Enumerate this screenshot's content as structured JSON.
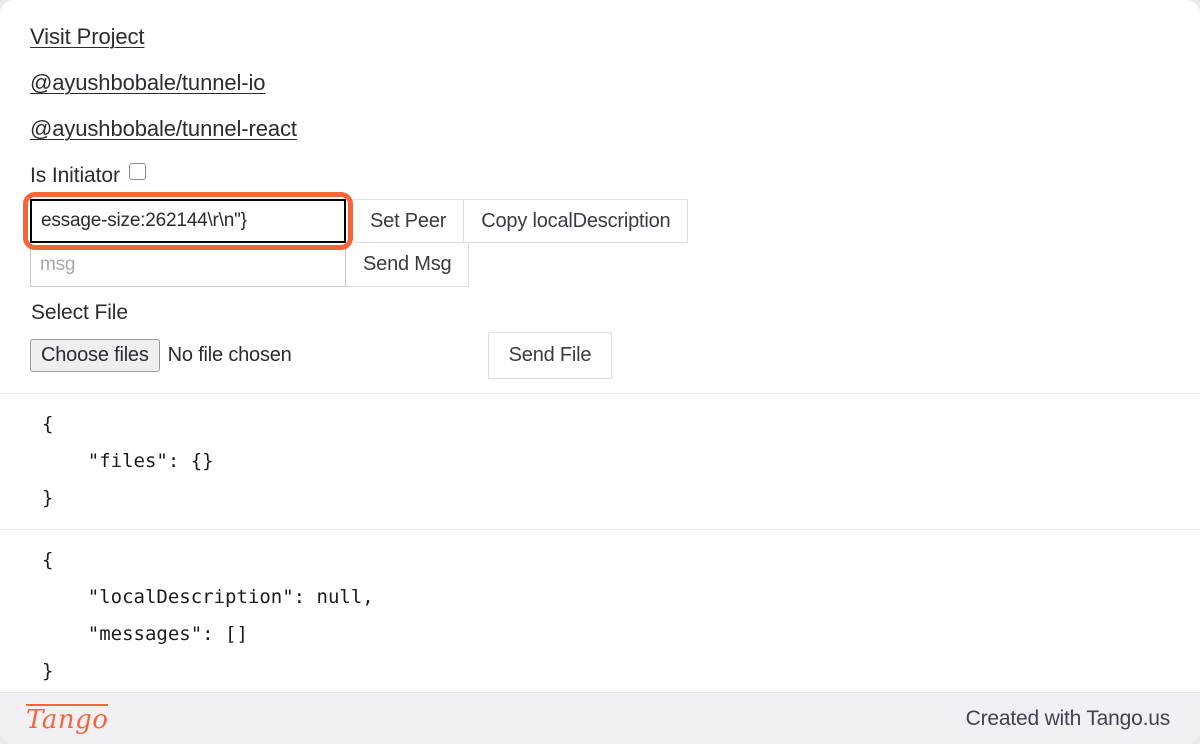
{
  "links": [
    {
      "label": "Visit Project",
      "name": "visit-project-link"
    },
    {
      "label": "@ayushbobale/tunnel-io",
      "name": "tunnel-io-link"
    },
    {
      "label": "@ayushbobale/tunnel-react",
      "name": "tunnel-react-link"
    }
  ],
  "initiator": {
    "label": "Is Initiator",
    "checked": false
  },
  "peer_row": {
    "input_value": "essage-size:262144\\r\\n\"}",
    "input_placeholder": "",
    "set_peer_label": "Set Peer",
    "copy_local_description_label": "Copy localDescription"
  },
  "msg_row": {
    "input_value": "",
    "input_placeholder": "msg",
    "send_msg_label": "Send Msg"
  },
  "file_section": {
    "select_file_label": "Select File",
    "choose_files_label": "Choose files",
    "no_file_chosen_label": "No file chosen",
    "send_file_label": "Send File"
  },
  "json_panels": [
    {
      "name": "files-state-panel",
      "text": "{\n    \"files\": {}\n}"
    },
    {
      "name": "connection-state-panel",
      "text": "{\n    \"localDescription\": null,\n    \"messages\": []\n}"
    }
  ],
  "footer": {
    "logo_text": "Tango",
    "credit": "Created with Tango.us"
  },
  "colors": {
    "highlight": "#f4663a",
    "link": "#2b2b33",
    "footer_bg": "#f1f0f5"
  }
}
